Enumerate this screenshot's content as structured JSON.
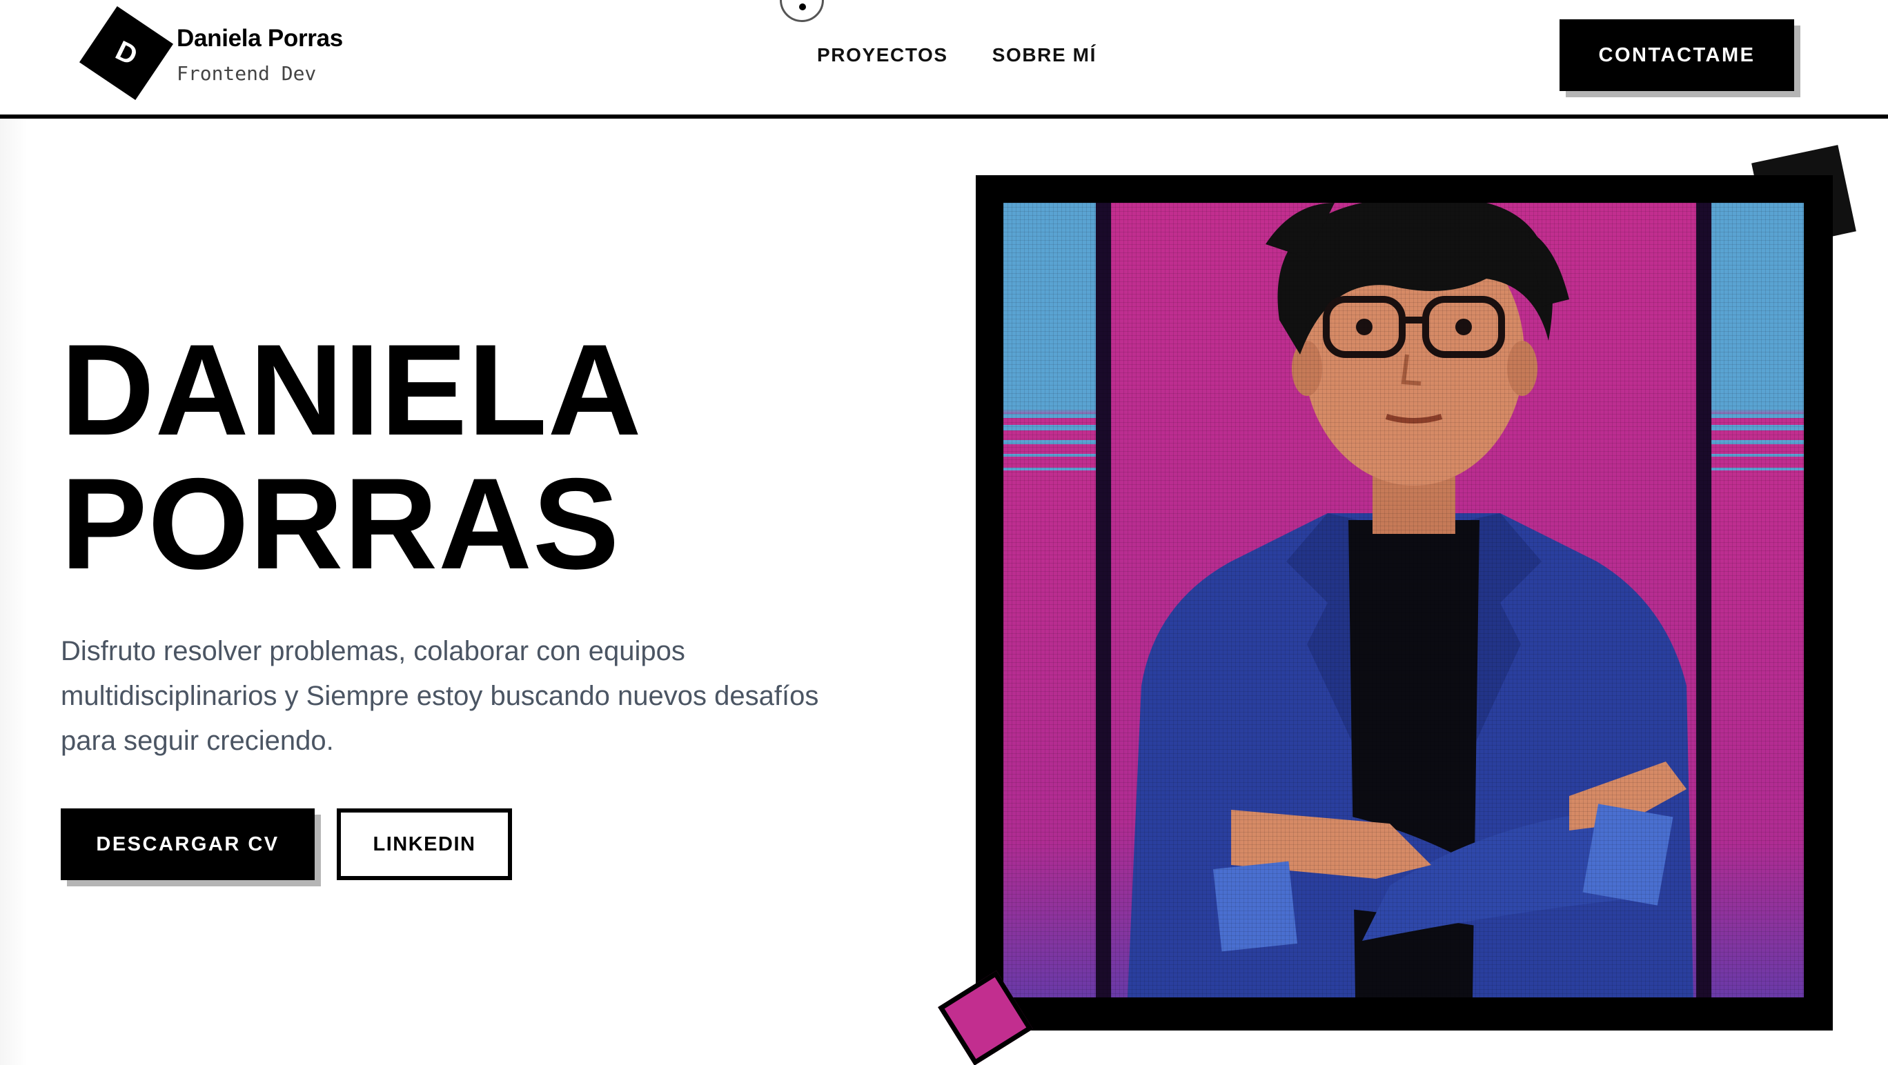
{
  "brand": {
    "logo_letter": "D",
    "name": "Daniela Porras",
    "role": "Frontend Dev"
  },
  "nav": {
    "items": [
      {
        "label": "PROYECTOS"
      },
      {
        "label": "SOBRE MÍ"
      }
    ],
    "contact_label": "CONTACTAME"
  },
  "hero": {
    "title_line1": "DANIELA",
    "title_line2": "PORRAS",
    "description": "Disfruto resolver problemas, colaborar con equipos multidisciplinarios y Siempre estoy buscando nuevos desafíos para seguir creciendo.",
    "cv_label": "DESCARGAR CV",
    "linkedin_label": "LINKEDIN"
  },
  "portrait": {
    "icon": "pixel-art-portrait",
    "colors": {
      "frame": "#000000",
      "background_magenta": "#c22e8f",
      "side_blue": "#5aa3d2",
      "jacket": "#2a3f9e",
      "jacket_highlight": "#4a6fd0",
      "skin": "#d68a66",
      "hair": "#111111",
      "shirt": "#0b0b12"
    }
  },
  "colors": {
    "accent": "#000000",
    "text_body": "#4b5563",
    "button_shadow": "#b5b5b5",
    "deco_pink": "#c22e8f"
  }
}
